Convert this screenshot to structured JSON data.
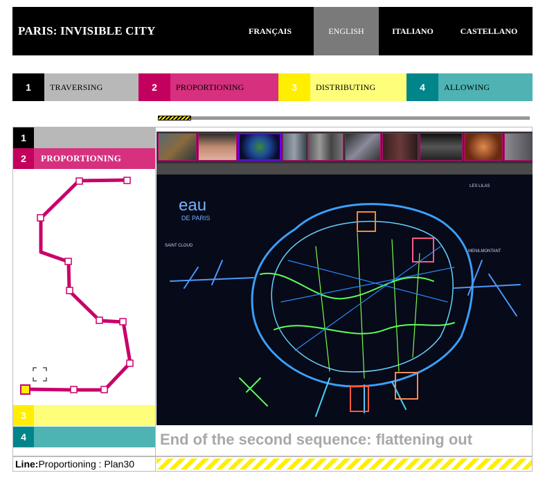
{
  "site": {
    "title": "PARIS: INVISIBLE CITY"
  },
  "languages": [
    {
      "label": "FRANÇAIS",
      "active": false
    },
    {
      "label": "ENGLISH",
      "active": true
    },
    {
      "label": "ITALIANO",
      "active": false
    },
    {
      "label": "CASTELLANO",
      "active": false
    }
  ],
  "chapters": [
    {
      "num": "1",
      "label": "TRAVERSING",
      "num_color": "#000000",
      "bg_color": "#b8b8b8"
    },
    {
      "num": "2",
      "label": "PROPORTIONING",
      "num_color": "#c4005e",
      "bg_color": "#d6307e"
    },
    {
      "num": "3",
      "label": "DISTRIBUTING",
      "num_color": "#ffee00",
      "bg_color": "#fffe7a"
    },
    {
      "num": "4",
      "label": "ALLOWING",
      "num_color": "#00858a",
      "bg_color": "#4fb3b3"
    }
  ],
  "progress": {
    "fraction": 0.09
  },
  "sidebar": {
    "rows": [
      {
        "num": "1",
        "title": ""
      },
      {
        "num": "2",
        "title": "PROPORTIONING"
      },
      {
        "num": "3",
        "title": ""
      },
      {
        "num": "4",
        "title": ""
      }
    ],
    "route_color": "#c8006a",
    "current_stop_color": "#ffee00"
  },
  "viewer": {
    "thumbnails_count": 13,
    "active_thumbnail": 3,
    "image_description_icon": "illuminated-map-icon",
    "map_texts": {
      "logo_line1": "eau",
      "logo_line2": "DE PARIS",
      "label_a": "LES LILAS",
      "label_b": "SAINT CLOUD",
      "label_c": "MENILMONTANT"
    }
  },
  "caption": "End of the second sequence: flattening out",
  "footer": {
    "line_label": "Line:",
    "line_value": "Proportioning : Plan30"
  }
}
